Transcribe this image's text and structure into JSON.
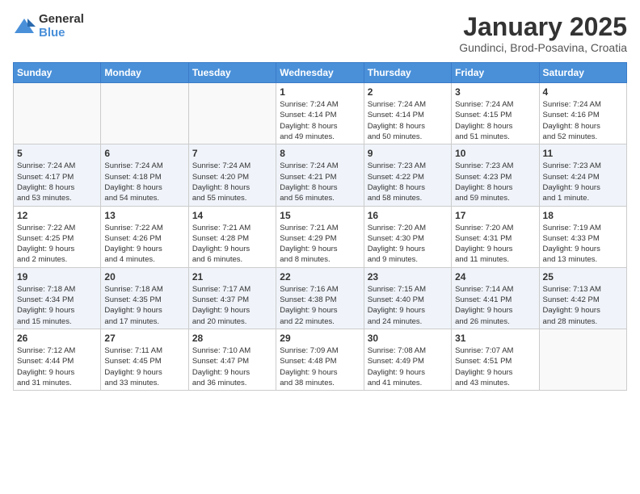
{
  "header": {
    "logo_general": "General",
    "logo_blue": "Blue",
    "title": "January 2025",
    "subtitle": "Gundinci, Brod-Posavina, Croatia"
  },
  "days_of_week": [
    "Sunday",
    "Monday",
    "Tuesday",
    "Wednesday",
    "Thursday",
    "Friday",
    "Saturday"
  ],
  "weeks": [
    [
      {
        "day": "",
        "info": ""
      },
      {
        "day": "",
        "info": ""
      },
      {
        "day": "",
        "info": ""
      },
      {
        "day": "1",
        "info": "Sunrise: 7:24 AM\nSunset: 4:14 PM\nDaylight: 8 hours\nand 49 minutes."
      },
      {
        "day": "2",
        "info": "Sunrise: 7:24 AM\nSunset: 4:14 PM\nDaylight: 8 hours\nand 50 minutes."
      },
      {
        "day": "3",
        "info": "Sunrise: 7:24 AM\nSunset: 4:15 PM\nDaylight: 8 hours\nand 51 minutes."
      },
      {
        "day": "4",
        "info": "Sunrise: 7:24 AM\nSunset: 4:16 PM\nDaylight: 8 hours\nand 52 minutes."
      }
    ],
    [
      {
        "day": "5",
        "info": "Sunrise: 7:24 AM\nSunset: 4:17 PM\nDaylight: 8 hours\nand 53 minutes."
      },
      {
        "day": "6",
        "info": "Sunrise: 7:24 AM\nSunset: 4:18 PM\nDaylight: 8 hours\nand 54 minutes."
      },
      {
        "day": "7",
        "info": "Sunrise: 7:24 AM\nSunset: 4:20 PM\nDaylight: 8 hours\nand 55 minutes."
      },
      {
        "day": "8",
        "info": "Sunrise: 7:24 AM\nSunset: 4:21 PM\nDaylight: 8 hours\nand 56 minutes."
      },
      {
        "day": "9",
        "info": "Sunrise: 7:23 AM\nSunset: 4:22 PM\nDaylight: 8 hours\nand 58 minutes."
      },
      {
        "day": "10",
        "info": "Sunrise: 7:23 AM\nSunset: 4:23 PM\nDaylight: 8 hours\nand 59 minutes."
      },
      {
        "day": "11",
        "info": "Sunrise: 7:23 AM\nSunset: 4:24 PM\nDaylight: 9 hours\nand 1 minute."
      }
    ],
    [
      {
        "day": "12",
        "info": "Sunrise: 7:22 AM\nSunset: 4:25 PM\nDaylight: 9 hours\nand 2 minutes."
      },
      {
        "day": "13",
        "info": "Sunrise: 7:22 AM\nSunset: 4:26 PM\nDaylight: 9 hours\nand 4 minutes."
      },
      {
        "day": "14",
        "info": "Sunrise: 7:21 AM\nSunset: 4:28 PM\nDaylight: 9 hours\nand 6 minutes."
      },
      {
        "day": "15",
        "info": "Sunrise: 7:21 AM\nSunset: 4:29 PM\nDaylight: 9 hours\nand 8 minutes."
      },
      {
        "day": "16",
        "info": "Sunrise: 7:20 AM\nSunset: 4:30 PM\nDaylight: 9 hours\nand 9 minutes."
      },
      {
        "day": "17",
        "info": "Sunrise: 7:20 AM\nSunset: 4:31 PM\nDaylight: 9 hours\nand 11 minutes."
      },
      {
        "day": "18",
        "info": "Sunrise: 7:19 AM\nSunset: 4:33 PM\nDaylight: 9 hours\nand 13 minutes."
      }
    ],
    [
      {
        "day": "19",
        "info": "Sunrise: 7:18 AM\nSunset: 4:34 PM\nDaylight: 9 hours\nand 15 minutes."
      },
      {
        "day": "20",
        "info": "Sunrise: 7:18 AM\nSunset: 4:35 PM\nDaylight: 9 hours\nand 17 minutes."
      },
      {
        "day": "21",
        "info": "Sunrise: 7:17 AM\nSunset: 4:37 PM\nDaylight: 9 hours\nand 20 minutes."
      },
      {
        "day": "22",
        "info": "Sunrise: 7:16 AM\nSunset: 4:38 PM\nDaylight: 9 hours\nand 22 minutes."
      },
      {
        "day": "23",
        "info": "Sunrise: 7:15 AM\nSunset: 4:40 PM\nDaylight: 9 hours\nand 24 minutes."
      },
      {
        "day": "24",
        "info": "Sunrise: 7:14 AM\nSunset: 4:41 PM\nDaylight: 9 hours\nand 26 minutes."
      },
      {
        "day": "25",
        "info": "Sunrise: 7:13 AM\nSunset: 4:42 PM\nDaylight: 9 hours\nand 28 minutes."
      }
    ],
    [
      {
        "day": "26",
        "info": "Sunrise: 7:12 AM\nSunset: 4:44 PM\nDaylight: 9 hours\nand 31 minutes."
      },
      {
        "day": "27",
        "info": "Sunrise: 7:11 AM\nSunset: 4:45 PM\nDaylight: 9 hours\nand 33 minutes."
      },
      {
        "day": "28",
        "info": "Sunrise: 7:10 AM\nSunset: 4:47 PM\nDaylight: 9 hours\nand 36 minutes."
      },
      {
        "day": "29",
        "info": "Sunrise: 7:09 AM\nSunset: 4:48 PM\nDaylight: 9 hours\nand 38 minutes."
      },
      {
        "day": "30",
        "info": "Sunrise: 7:08 AM\nSunset: 4:49 PM\nDaylight: 9 hours\nand 41 minutes."
      },
      {
        "day": "31",
        "info": "Sunrise: 7:07 AM\nSunset: 4:51 PM\nDaylight: 9 hours\nand 43 minutes."
      },
      {
        "day": "",
        "info": ""
      }
    ]
  ]
}
